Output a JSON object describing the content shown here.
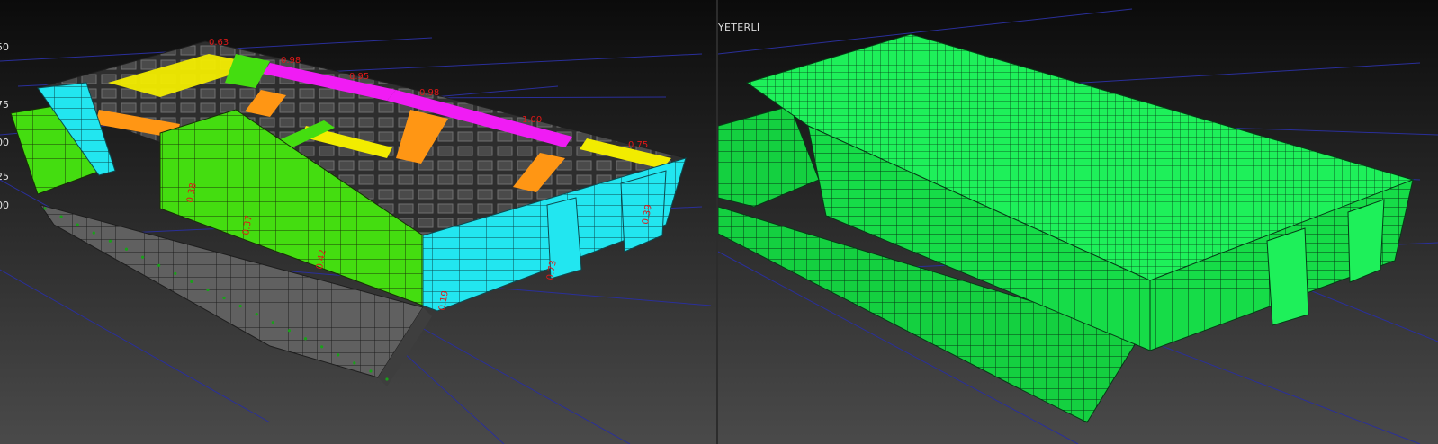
{
  "left_viewport": {
    "legend_ticks": [
      "50",
      "75",
      "00",
      "25",
      "00"
    ],
    "ratio_labels": [
      "0.63",
      "0.98",
      "0.95",
      "0.98",
      "1.00",
      "0.75",
      "0.39",
      "0.42",
      "0.37",
      "0.38",
      "0.19",
      "0.73"
    ]
  },
  "right_viewport": {
    "status_label": "YETERLİ"
  },
  "colors": {
    "background_top": "#0b0b0b",
    "background_bottom": "#4a4a4a",
    "grid_line": "#2a2f9a",
    "mesh_gray": "#5f5f5f",
    "cell_gray": "#3c3c3c",
    "green": "#44dd10",
    "cyan": "#22e6f0",
    "yellow": "#f2ec00",
    "orange": "#ff9614",
    "magenta": "#f01cf4",
    "label_red": "#e01818",
    "right_green": "#14d040",
    "right_green_light": "#1ef05a"
  }
}
